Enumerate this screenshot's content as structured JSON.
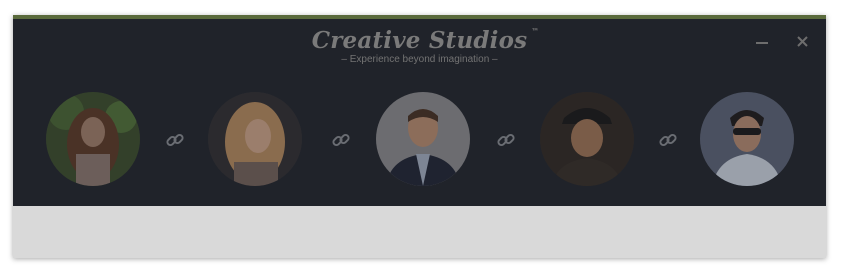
{
  "app": {
    "title": "Creative Studios",
    "trademark": "™",
    "tagline": "– Experience beyond imagination –"
  },
  "window_controls": {
    "minimize": "minimize-icon",
    "close": "close-icon",
    "close_glyph": "✕"
  },
  "colors": {
    "accent_bar": "#5a6a3c",
    "header_bg": "#20232a",
    "footer_bg": "#d9d9d9",
    "brand_text": "#7a7a7a",
    "link_icon": "#6a6d73"
  },
  "avatars": [
    {
      "name": "avatar-1",
      "depiction": "woman with long brown hair, greenery background"
    },
    {
      "name": "avatar-2",
      "depiction": "smiling woman with blonde hair"
    },
    {
      "name": "avatar-3",
      "depiction": "man in dark suit, light background"
    },
    {
      "name": "avatar-4",
      "depiction": "smiling man wearing cap"
    },
    {
      "name": "avatar-5",
      "depiction": "man with sunglasses"
    }
  ],
  "connectors": [
    "link-icon",
    "link-icon",
    "link-icon",
    "link-icon"
  ]
}
